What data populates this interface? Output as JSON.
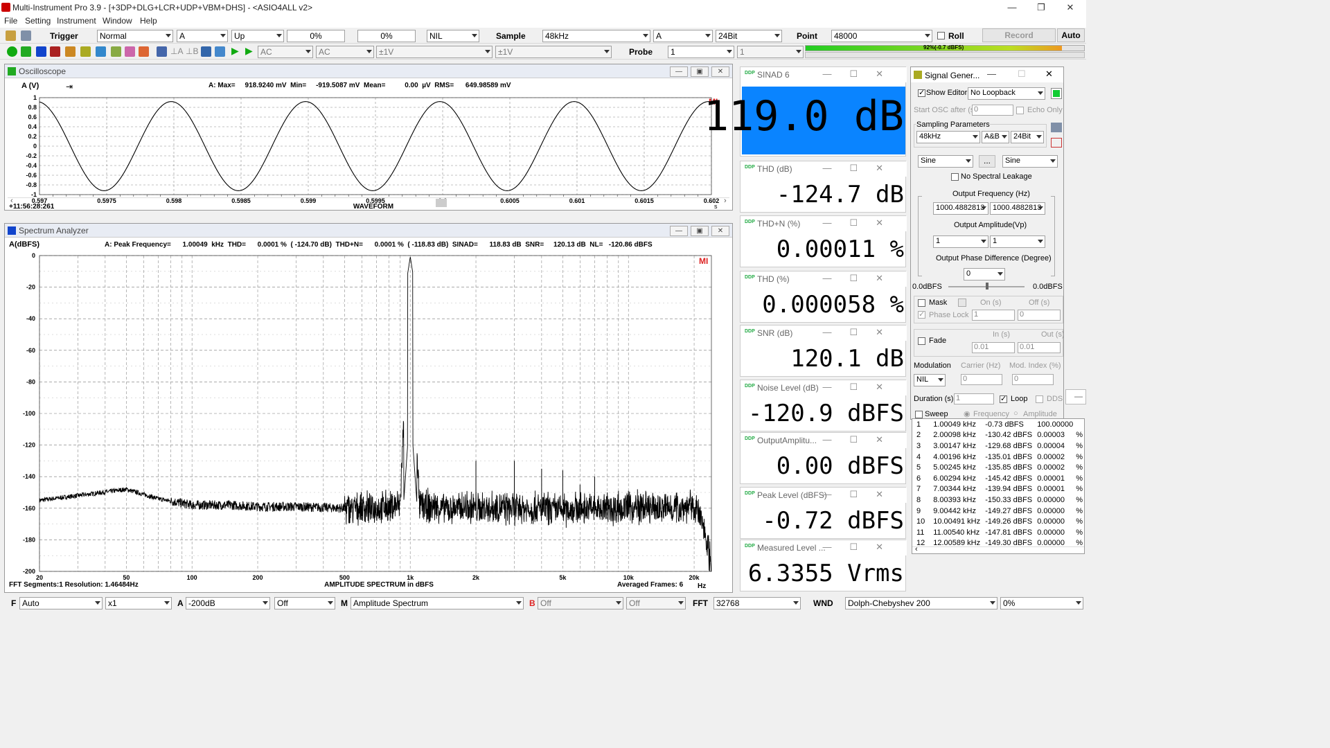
{
  "title": "Multi-Instrument Pro 3.9 - [+3DP+DLG+LCR+UDP+VBM+DHS] - <ASIO4ALL v2>",
  "menu": [
    "File",
    "Setting",
    "Instrument",
    "Window",
    "Help"
  ],
  "toolbar1": {
    "trigger_label": "Trigger",
    "trigger_mode": "Normal",
    "trigger_ch": "A",
    "trigger_edge": "Up",
    "trig_pct1": "0%",
    "trig_pct2": "0%",
    "trig_nil": "NIL",
    "sample_label": "Sample",
    "sample_rate": "48kHz",
    "sample_ch": "A",
    "bits": "24Bit",
    "point_label": "Point",
    "points": "48000",
    "roll_label": "Roll",
    "record_label": "Record",
    "auto_label": "Auto"
  },
  "toolbar2": {
    "coupling_a": "AC",
    "coupling_b": "AC",
    "range_a": "±1V",
    "range_b": "±1V",
    "probe_label": "Probe",
    "probe_a": "1",
    "probe_b": "1",
    "level_text": "92%(-0.7 dBFS)",
    "level_fraction": 0.92
  },
  "oscilloscope": {
    "title": "Oscilloscope",
    "ylabel": "A (V)",
    "stats": "A: Max=     918.9240 mV  Min=     -919.5087 mV  Mean=          0.00  µV  RMS=      649.98589 mV",
    "yticks": [
      "1",
      "0.8",
      "0.6",
      "0.4",
      "0.2",
      "0",
      "-0.2",
      "-0.4",
      "-0.6",
      "-0.8",
      "-1"
    ],
    "xticks": [
      "0.597",
      "0.5975",
      "0.598",
      "0.5985",
      "0.599",
      "0.5995",
      "0.6",
      "0.6005",
      "0.601",
      "0.6015",
      "0.602"
    ],
    "xlabel": "WAVEFORM",
    "timestamp": "+11:56:28:261",
    "xunit": "s",
    "logo": "MI"
  },
  "spectrum": {
    "title": "Spectrum Analyzer",
    "ylabel": "A(dBFS)",
    "stats": "A: Peak Frequency=      1.00049  kHz  THD=      0.0001 %  ( -124.70 dB)  THD+N=      0.0001 %  ( -118.83 dB)  SINAD=      118.83 dB  SNR=     120.13 dB  NL=   -120.86 dBFS",
    "yticks": [
      "0",
      "-20",
      "-40",
      "-60",
      "-80",
      "-100",
      "-120",
      "-140",
      "-160",
      "-180",
      "-200"
    ],
    "xticks": [
      "20",
      "50",
      "100",
      "200",
      "500",
      "1k",
      "2k",
      "5k",
      "10k",
      "20k"
    ],
    "xlabel": "AMPLITUDE SPECTRUM in dBFS",
    "xunit": "Hz",
    "footer_left": "FFT Segments:1   Resolution:  1.46484Hz",
    "footer_right": "Averaged Frames:  6",
    "logo": "MI"
  },
  "chart_data": [
    {
      "type": "line",
      "title": "WAVEFORM",
      "ylabel": "A (V)",
      "xunit": "s",
      "xlim": [
        0.597,
        0.602
      ],
      "ylim": [
        -1,
        1
      ],
      "grid": true,
      "series": [
        {
          "frequency_hz": 1000.49,
          "amplitude_v": 0.919,
          "x_start": 0.597,
          "x_end": 0.602
        }
      ]
    },
    {
      "type": "line",
      "title": "AMPLITUDE SPECTRUM in dBFS",
      "ylabel": "A(dBFS)",
      "xunit": "Hz",
      "xscale": "log",
      "xlim": [
        20,
        24000
      ],
      "ylim": [
        -200,
        0
      ],
      "grid": true,
      "series": [
        {
          "x": [
            20,
            30,
            50,
            70,
            100,
            150,
            200,
            300,
            500,
            700,
            900,
            1000,
            1100,
            1500,
            2000,
            3000,
            5000,
            7000,
            10000,
            15000,
            20000,
            22000,
            24000
          ],
          "y": [
            -155,
            -152,
            -148,
            -154,
            -158,
            -158,
            -159,
            -159,
            -160,
            -160,
            -158,
            -1,
            -158,
            -160,
            -160,
            -160,
            -161,
            -160,
            -160,
            -160,
            -159,
            -170,
            -195
          ]
        }
      ],
      "harmonic_peaks": {
        "x": [
          2000,
          3000,
          4000,
          5000,
          6000,
          7000,
          8000,
          9000,
          10000,
          11000,
          12000
        ],
        "y": [
          -130,
          -130,
          -135,
          -136,
          -145,
          -140,
          -150,
          -149,
          -149,
          -148,
          -149
        ]
      }
    }
  ],
  "meters": [
    {
      "title": "SINAD  6",
      "value": "119.0  dB",
      "highlight": true
    },
    {
      "title": "THD (dB)",
      "value": "-124.7  dB"
    },
    {
      "title": "THD+N (%)",
      "value": "0.00011  %"
    },
    {
      "title": "THD (%)",
      "value": "0.000058  %"
    },
    {
      "title": "SNR (dB)",
      "value": "120.1  dB"
    },
    {
      "title": "Noise Level (dB)",
      "value": "-120.9  dBFS"
    },
    {
      "title": "OutputAmplitu...",
      "value": "0.00  dBFS"
    },
    {
      "title": "Peak Level (dBFS)",
      "value": "-0.72  dBFS"
    },
    {
      "title": "Measured Level ...",
      "value": "6.3355  Vrms"
    }
  ],
  "siggen": {
    "title": "Signal Gener...",
    "show_editor": "Show Editor",
    "loopback": "No Loopback",
    "start_osc": "Start OSC after (s)",
    "start_osc_val": "0",
    "echo_only": "Echo Only",
    "sampling_params": "Sampling Parameters",
    "sg_rate": "48kHz",
    "sg_ch": "A&B",
    "sg_bits": "24Bit",
    "wave_a": "Sine",
    "wave_b": "Sine",
    "dots": "...",
    "no_leak": "No Spectral Leakage",
    "out_freq": "Output Frequency (Hz)",
    "freq_a": "1000.4882813",
    "freq_b": "1000.4882813",
    "out_amp": "Output Amplitude(Vp)",
    "amp_a": "1",
    "amp_b": "1",
    "out_phase": "Output Phase Difference (Degree)",
    "phase": "0",
    "db_left": "0.0dBFS",
    "db_right": "0.0dBFS",
    "mask": "Mask",
    "on_s": "On (s)",
    "off_s": "Off (s)",
    "phase_lock": "Phase Lock",
    "on_val": "1",
    "off_val": "0",
    "fade": "Fade",
    "in_s": "In (s)",
    "out_s": "Out (s)",
    "in_val": "0.01",
    "out_val": "0.01",
    "modulation": "Modulation",
    "carrier": "Carrier (Hz)",
    "mod_index": "Mod. Index (%)",
    "mod_type": "NIL",
    "carrier_val": "0",
    "mod_val": "0",
    "duration": "Duration (s)",
    "duration_val": "1",
    "loop": "Loop",
    "dds": "DDS",
    "sweep": "Sweep",
    "frequency": "Frequency",
    "amplitude": "Amplitude"
  },
  "harmonics": [
    [
      "1",
      "1.00049 kHz",
      "-0.73 dBFS",
      "100.00000",
      ""
    ],
    [
      "2",
      "2.00098 kHz",
      "-130.42 dBFS",
      "0.00003",
      "%"
    ],
    [
      "3",
      "3.00147 kHz",
      "-129.68 dBFS",
      "0.00004",
      "%"
    ],
    [
      "4",
      "4.00196 kHz",
      "-135.01 dBFS",
      "0.00002",
      "%"
    ],
    [
      "5",
      "5.00245 kHz",
      "-135.85 dBFS",
      "0.00002",
      "%"
    ],
    [
      "6",
      "6.00294 kHz",
      "-145.42 dBFS",
      "0.00001",
      "%"
    ],
    [
      "7",
      "7.00344 kHz",
      "-139.94 dBFS",
      "0.00001",
      "%"
    ],
    [
      "8",
      "8.00393 kHz",
      "-150.33 dBFS",
      "0.00000",
      "%"
    ],
    [
      "9",
      "9.00442 kHz",
      "-149.27 dBFS",
      "0.00000",
      "%"
    ],
    [
      "10",
      "10.00491 kHz",
      "-149.26 dBFS",
      "0.00000",
      "%"
    ],
    [
      "11",
      "11.00540 kHz",
      "-147.81 dBFS",
      "0.00000",
      "%"
    ],
    [
      "12",
      "12.00589 kHz",
      "-149.30 dBFS",
      "0.00000",
      "%"
    ]
  ],
  "bottombar": {
    "f_label": "F",
    "f_val": "Auto",
    "mult": "x1",
    "a_label": "A",
    "a_range": "-200dB",
    "a_off": "Off",
    "m_label": "M",
    "m_val": "Amplitude Spectrum",
    "b_label": "B",
    "b_off1": "Off",
    "b_off2": "Off",
    "fft_label": "FFT",
    "fft_val": "32768",
    "wnd_label": "WND",
    "wnd_val": "Dolph-Chebyshev 200",
    "pct": "0%"
  }
}
